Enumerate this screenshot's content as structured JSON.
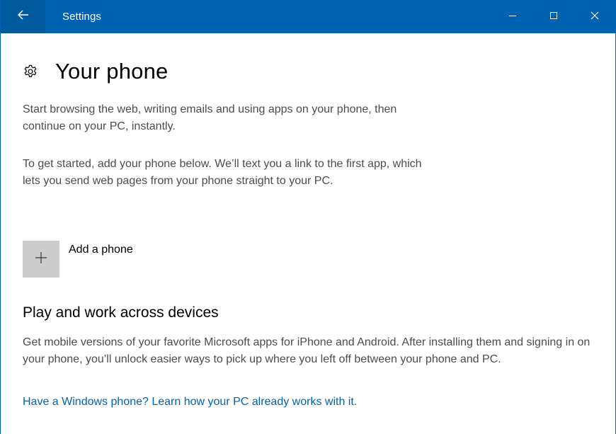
{
  "window": {
    "title": "Settings",
    "accent_color": "#0063b1"
  },
  "titlebar": {
    "back_icon": "back-arrow-icon",
    "minimize_icon": "minimize-icon",
    "maximize_icon": "maximize-icon",
    "close_icon": "close-icon"
  },
  "page": {
    "icon": "gear-icon",
    "title": "Your phone",
    "intro": "Start browsing the web, writing emails and using apps on your phone, then continue on your PC, instantly.",
    "instructions": "To get started, add your phone below. We’ll text you a link to the first app, which lets you send web pages from your phone straight to your PC.",
    "add_phone": {
      "icon": "plus-icon",
      "label": "Add a phone"
    }
  },
  "section": {
    "title": "Play and work across devices",
    "body": "Get mobile versions of your favorite Microsoft apps for iPhone and Android. After installing them and signing in on your phone, you’ll unlock easier ways to pick up where you left off between your phone and PC.",
    "link": "Have a Windows phone? Learn how your PC already works with it."
  }
}
